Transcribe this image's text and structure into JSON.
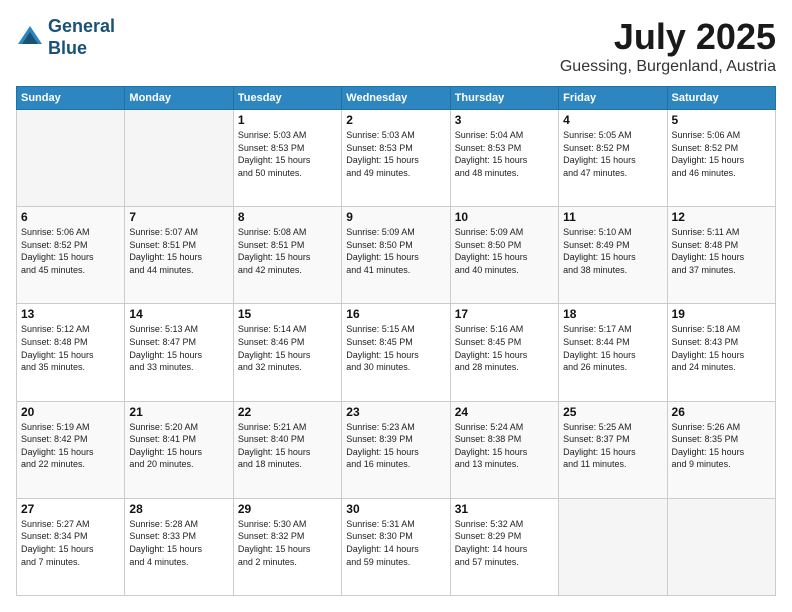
{
  "logo": {
    "line1": "General",
    "line2": "Blue"
  },
  "header": {
    "month": "July 2025",
    "location": "Guessing, Burgenland, Austria"
  },
  "weekdays": [
    "Sunday",
    "Monday",
    "Tuesday",
    "Wednesday",
    "Thursday",
    "Friday",
    "Saturday"
  ],
  "weeks": [
    [
      {
        "day": "",
        "info": ""
      },
      {
        "day": "",
        "info": ""
      },
      {
        "day": "1",
        "info": "Sunrise: 5:03 AM\nSunset: 8:53 PM\nDaylight: 15 hours\nand 50 minutes."
      },
      {
        "day": "2",
        "info": "Sunrise: 5:03 AM\nSunset: 8:53 PM\nDaylight: 15 hours\nand 49 minutes."
      },
      {
        "day": "3",
        "info": "Sunrise: 5:04 AM\nSunset: 8:53 PM\nDaylight: 15 hours\nand 48 minutes."
      },
      {
        "day": "4",
        "info": "Sunrise: 5:05 AM\nSunset: 8:52 PM\nDaylight: 15 hours\nand 47 minutes."
      },
      {
        "day": "5",
        "info": "Sunrise: 5:06 AM\nSunset: 8:52 PM\nDaylight: 15 hours\nand 46 minutes."
      }
    ],
    [
      {
        "day": "6",
        "info": "Sunrise: 5:06 AM\nSunset: 8:52 PM\nDaylight: 15 hours\nand 45 minutes."
      },
      {
        "day": "7",
        "info": "Sunrise: 5:07 AM\nSunset: 8:51 PM\nDaylight: 15 hours\nand 44 minutes."
      },
      {
        "day": "8",
        "info": "Sunrise: 5:08 AM\nSunset: 8:51 PM\nDaylight: 15 hours\nand 42 minutes."
      },
      {
        "day": "9",
        "info": "Sunrise: 5:09 AM\nSunset: 8:50 PM\nDaylight: 15 hours\nand 41 minutes."
      },
      {
        "day": "10",
        "info": "Sunrise: 5:09 AM\nSunset: 8:50 PM\nDaylight: 15 hours\nand 40 minutes."
      },
      {
        "day": "11",
        "info": "Sunrise: 5:10 AM\nSunset: 8:49 PM\nDaylight: 15 hours\nand 38 minutes."
      },
      {
        "day": "12",
        "info": "Sunrise: 5:11 AM\nSunset: 8:48 PM\nDaylight: 15 hours\nand 37 minutes."
      }
    ],
    [
      {
        "day": "13",
        "info": "Sunrise: 5:12 AM\nSunset: 8:48 PM\nDaylight: 15 hours\nand 35 minutes."
      },
      {
        "day": "14",
        "info": "Sunrise: 5:13 AM\nSunset: 8:47 PM\nDaylight: 15 hours\nand 33 minutes."
      },
      {
        "day": "15",
        "info": "Sunrise: 5:14 AM\nSunset: 8:46 PM\nDaylight: 15 hours\nand 32 minutes."
      },
      {
        "day": "16",
        "info": "Sunrise: 5:15 AM\nSunset: 8:45 PM\nDaylight: 15 hours\nand 30 minutes."
      },
      {
        "day": "17",
        "info": "Sunrise: 5:16 AM\nSunset: 8:45 PM\nDaylight: 15 hours\nand 28 minutes."
      },
      {
        "day": "18",
        "info": "Sunrise: 5:17 AM\nSunset: 8:44 PM\nDaylight: 15 hours\nand 26 minutes."
      },
      {
        "day": "19",
        "info": "Sunrise: 5:18 AM\nSunset: 8:43 PM\nDaylight: 15 hours\nand 24 minutes."
      }
    ],
    [
      {
        "day": "20",
        "info": "Sunrise: 5:19 AM\nSunset: 8:42 PM\nDaylight: 15 hours\nand 22 minutes."
      },
      {
        "day": "21",
        "info": "Sunrise: 5:20 AM\nSunset: 8:41 PM\nDaylight: 15 hours\nand 20 minutes."
      },
      {
        "day": "22",
        "info": "Sunrise: 5:21 AM\nSunset: 8:40 PM\nDaylight: 15 hours\nand 18 minutes."
      },
      {
        "day": "23",
        "info": "Sunrise: 5:23 AM\nSunset: 8:39 PM\nDaylight: 15 hours\nand 16 minutes."
      },
      {
        "day": "24",
        "info": "Sunrise: 5:24 AM\nSunset: 8:38 PM\nDaylight: 15 hours\nand 13 minutes."
      },
      {
        "day": "25",
        "info": "Sunrise: 5:25 AM\nSunset: 8:37 PM\nDaylight: 15 hours\nand 11 minutes."
      },
      {
        "day": "26",
        "info": "Sunrise: 5:26 AM\nSunset: 8:35 PM\nDaylight: 15 hours\nand 9 minutes."
      }
    ],
    [
      {
        "day": "27",
        "info": "Sunrise: 5:27 AM\nSunset: 8:34 PM\nDaylight: 15 hours\nand 7 minutes."
      },
      {
        "day": "28",
        "info": "Sunrise: 5:28 AM\nSunset: 8:33 PM\nDaylight: 15 hours\nand 4 minutes."
      },
      {
        "day": "29",
        "info": "Sunrise: 5:30 AM\nSunset: 8:32 PM\nDaylight: 15 hours\nand 2 minutes."
      },
      {
        "day": "30",
        "info": "Sunrise: 5:31 AM\nSunset: 8:30 PM\nDaylight: 14 hours\nand 59 minutes."
      },
      {
        "day": "31",
        "info": "Sunrise: 5:32 AM\nSunset: 8:29 PM\nDaylight: 14 hours\nand 57 minutes."
      },
      {
        "day": "",
        "info": ""
      },
      {
        "day": "",
        "info": ""
      }
    ]
  ]
}
